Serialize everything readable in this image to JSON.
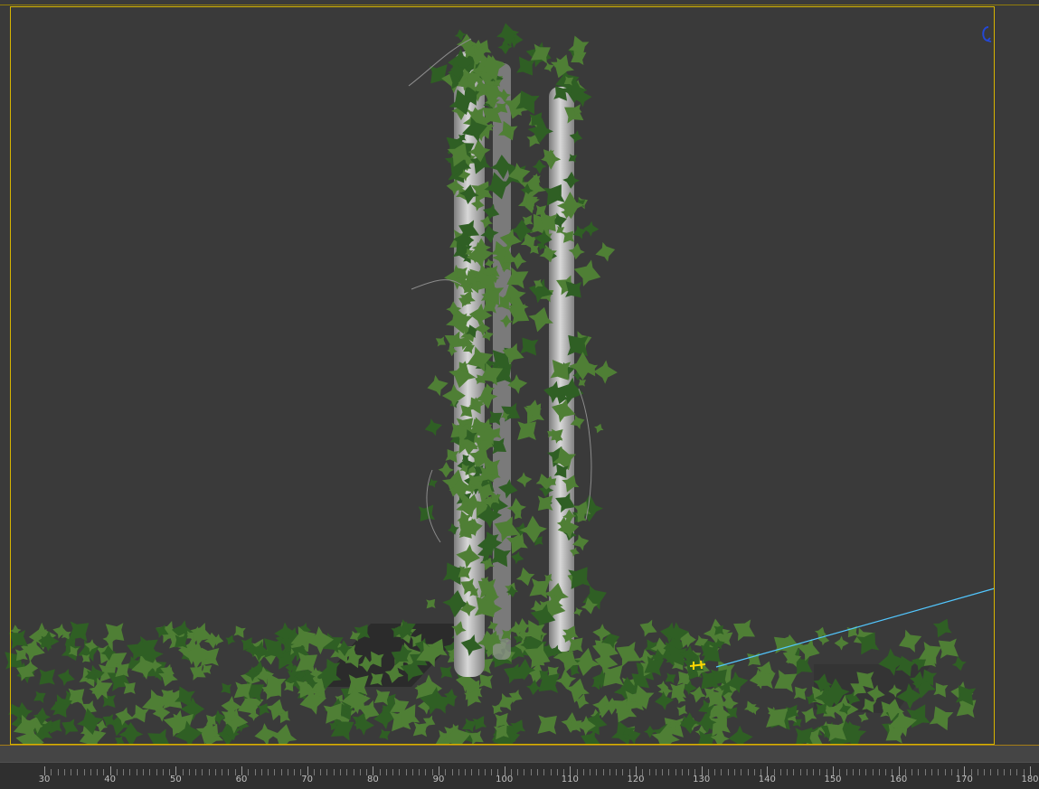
{
  "app": {
    "name": "3D viewport"
  },
  "viewport": {
    "colors": {
      "background": "#3a3a3a",
      "safe_frame": "#d6b400",
      "pillar": "#b9b9b9",
      "foliage": "#4f7f35",
      "foliage_dark": "#2f5f24",
      "guide_line": "#52c7ff",
      "selection_marker": "#ffd500",
      "viewcube": "#2448d6"
    }
  },
  "timeline": {
    "labels": [
      "30",
      "40",
      "50",
      "60",
      "70",
      "80",
      "90",
      "100",
      "110",
      "120",
      "130",
      "140",
      "150",
      "160",
      "170",
      "180"
    ]
  }
}
